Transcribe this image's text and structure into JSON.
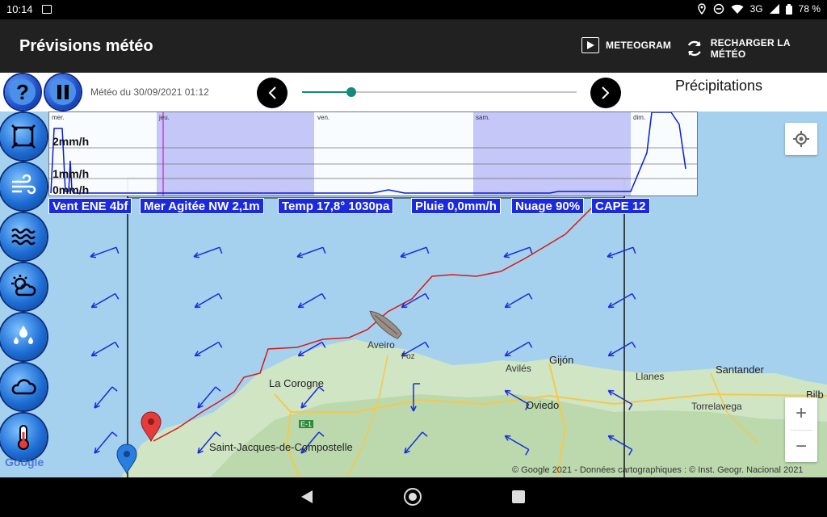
{
  "status": {
    "time": "10:14",
    "network": "3G",
    "battery": "78 %"
  },
  "appbar": {
    "title": "Prévisions météo",
    "meteogram_label": "METEOGRAM",
    "reload_label": "RECHARGER LA MÉTÉO"
  },
  "controls": {
    "help_label": "?",
    "date_label": "Météo du  30/09/2021 01:12",
    "slider_value": 0.18,
    "layer_title": "Précipitations"
  },
  "graph": {
    "days": [
      "mer.",
      "jeu.",
      "ven.",
      "sam.",
      "dim."
    ],
    "y_labels": [
      "2mm/h",
      "1mm/h",
      "0mm/h"
    ]
  },
  "info": {
    "wind": "Vent ENE 4bf",
    "sea": "Mer Agitée NW 2,1m",
    "temp": "Temp 17,8° 1030pa",
    "rain": "Pluie 0,0mm/h",
    "cloud": "Nuage 90%",
    "cape": "CAPE 12"
  },
  "map": {
    "labels": {
      "aveiro": "Aveiro",
      "foz": "Foz",
      "gijon": "Gijón",
      "aviles": "Avilés",
      "llanes": "Llanes",
      "santander": "Santander",
      "bilbao": "Bilb",
      "lacorogne": "La Corogne",
      "oviedo": "Oviedo",
      "torrelavega": "Torrelavega",
      "santiago": "Saint-Jacques-de-Compostelle",
      "road": "E-1"
    },
    "credits": "© Google 2021 - Données cartographiques : © Inst. Geogr. Nacional 2021",
    "google": "Google",
    "zoom_in": "+",
    "zoom_out": "−"
  }
}
